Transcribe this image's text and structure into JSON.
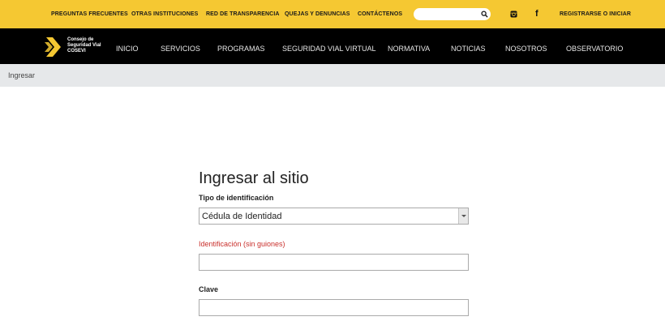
{
  "topbar": {
    "links": [
      "PREGUNTAS FRECUENTES",
      "OTRAS INSTITUCIONES",
      "RED DE TRANSPARENCIA",
      "QUEJAS Y DENUNCIAS",
      "CONTÁCTENOS"
    ],
    "search_placeholder": "",
    "facebook_glyph": "f",
    "register_label": "REGISTRARSE O INICIAR"
  },
  "brand": {
    "line1": "Consejo de",
    "line2": "Seguridad Vial",
    "line3": "COSEVI"
  },
  "nav": {
    "items": [
      "INICIO",
      "SERVICIOS",
      "PROGRAMAS",
      "SEGURIDAD VIAL VIRTUAL",
      "NORMATIVA",
      "NOTICIAS",
      "NOSOTROS",
      "OBSERVATORIO"
    ]
  },
  "breadcrumb": {
    "current": "Ingresar"
  },
  "form": {
    "title": "Ingresar al sitio",
    "id_type_label": "Tipo de identificación",
    "id_type_value": "Cédula de Identidad",
    "id_label": "Identificación (sin guiones)",
    "id_value": "",
    "password_label": "Clave",
    "password_value": ""
  },
  "colors": {
    "accent_yellow": "#f5c832",
    "nav_black": "#000000",
    "required_red": "#c9302c"
  },
  "icons": [
    "search-icon",
    "instagram-icon",
    "facebook-icon",
    "cosevi-logo-icon",
    "chevron-down-icon"
  ]
}
